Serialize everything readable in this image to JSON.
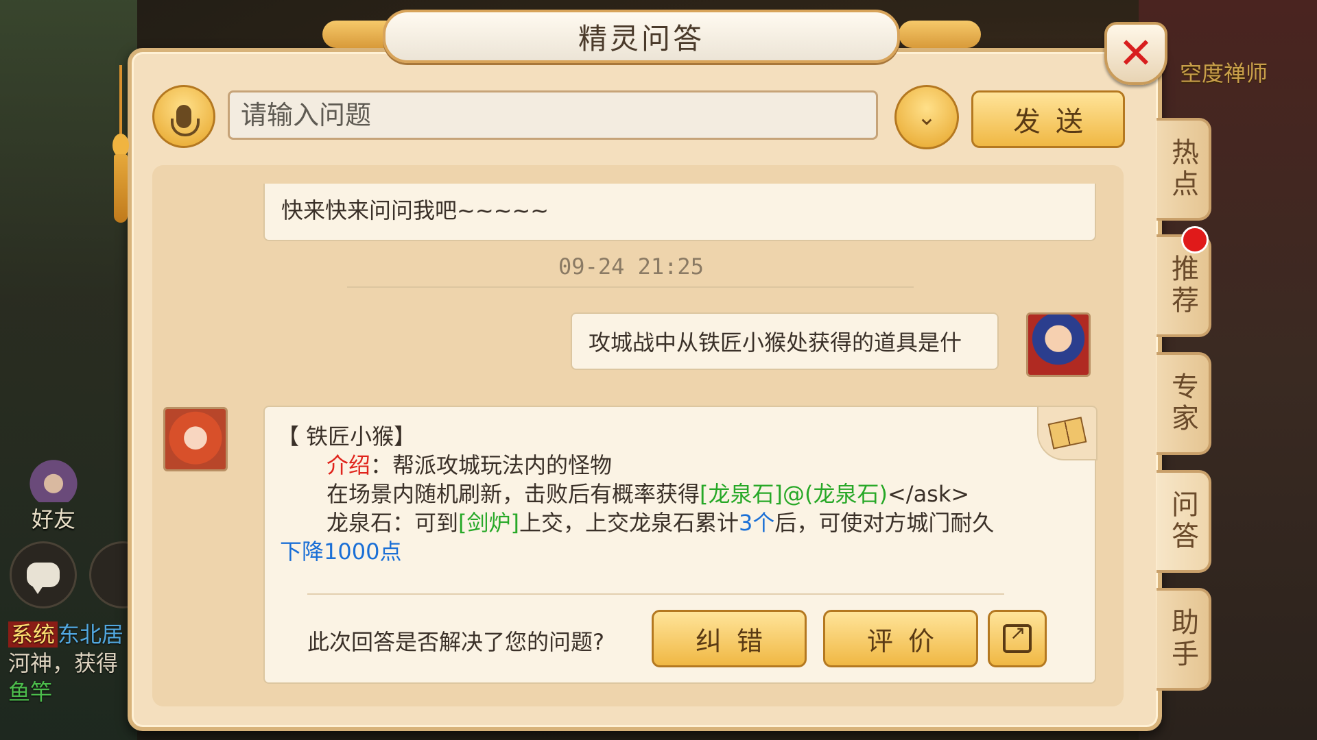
{
  "background": {
    "npc_name": "空度禅师",
    "friend_label": "好友",
    "system_chat": {
      "tag": "系统",
      "place": "东北居",
      "line2": "河神，获得",
      "item": "鱼竿"
    }
  },
  "dialog": {
    "title": "精灵问答",
    "close": "✕",
    "search": {
      "placeholder": "请输入问题",
      "value": ""
    },
    "dropdown_glyph": "⌄",
    "send_label": "发送"
  },
  "side_tabs": [
    {
      "label": "热点"
    },
    {
      "label": "推荐"
    },
    {
      "label": "专家"
    },
    {
      "label": "问答"
    },
    {
      "label": "助手"
    }
  ],
  "messages": {
    "previous_text": "快来快来问问我吧~~~~~",
    "timestamp": "09-24 21:25",
    "user_question": "攻城战中从铁匠小猴处获得的道具是什",
    "answer": {
      "heading": "【 铁匠小猴】",
      "intro_label": "介绍",
      "intro_text": "：帮派攻城玩法内的怪物",
      "line2_prefix": "在场景内随机刷新，击败后有概率获得",
      "line2_link": "[龙泉石]@(龙泉石)",
      "line2_suffix": "</ask>",
      "line3_prefix": "龙泉石：可到",
      "line3_link": "[剑炉]",
      "line3_mid": "上交，上交龙泉石累计",
      "line3_count": "3个",
      "line3_suffix": "后，可使对方城门耐久",
      "line4": "下降1000点"
    },
    "feedback_question": "此次回答是否解决了您的问题?",
    "correct_label": "纠错",
    "rate_label": "评价"
  },
  "colors": {
    "dialog_bg": "#f4dfbe",
    "button_gold": "#f0b844",
    "highlight_red": "#e0241c",
    "highlight_green": "#27a827",
    "highlight_blue": "#1a6fd6"
  }
}
